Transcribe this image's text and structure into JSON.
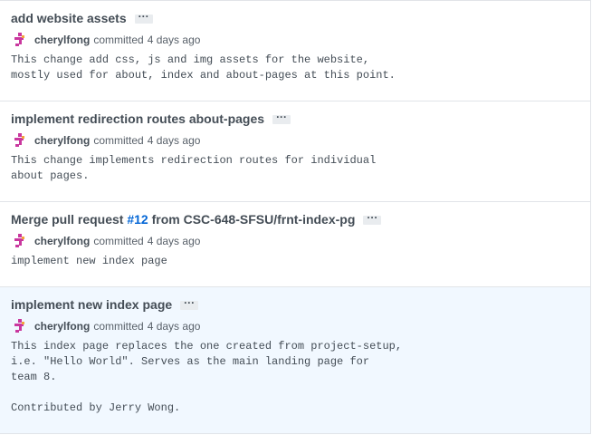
{
  "commits": [
    {
      "title": "add website assets",
      "expander": "···",
      "author": "cherylfong",
      "verb": "committed",
      "time": "4 days ago",
      "body": "This change add css, js and img assets for the website,\nmostly used for about, index and about-pages at this point."
    },
    {
      "title": "implement redirection routes about-pages",
      "expander": "···",
      "author": "cherylfong",
      "verb": "committed",
      "time": "4 days ago",
      "body": "This change implements redirection routes for individual\nabout pages."
    },
    {
      "title_prefix": "Merge pull request ",
      "pr_link": "#12",
      "title_suffix": " from CSC-648-SFSU/frnt-index-pg",
      "expander": "···",
      "author": "cherylfong",
      "verb": "committed",
      "time": "4 days ago",
      "body": "implement new index page"
    },
    {
      "title": "implement new index page",
      "expander": "···",
      "author": "cherylfong",
      "verb": "committed",
      "time": "4 days ago",
      "body": "This index page replaces the one created from project-setup,\ni.e. \"Hello World\". Serves as the main landing page for\nteam 8.\n\nContributed by Jerry Wong."
    }
  ],
  "colors": {
    "link": "#0366d6",
    "selected_bg": "#f1f8ff",
    "border": "#e1e4e8",
    "avatar_magenta": "#c9379e",
    "avatar_orange": "#f2a33a"
  },
  "icons": {
    "avatar": "identicon-avatar"
  }
}
